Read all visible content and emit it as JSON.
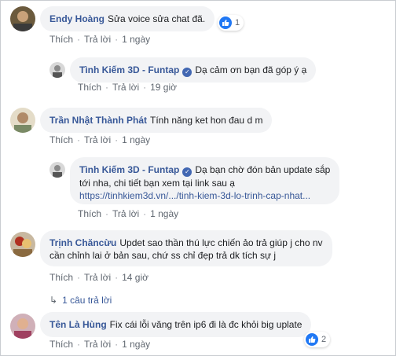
{
  "comments": [
    {
      "author": "Endy Hoàng",
      "text": "Sửa voice sửa chat đã.",
      "reaction_count": "1",
      "actions": {
        "like": "Thích",
        "reply": "Trả lời",
        "time": "1 ngày"
      },
      "reply": {
        "author": "Tình Kiếm 3D - Funtap",
        "text": "Dạ cảm ơn bạn đã góp ý ạ",
        "actions": {
          "like": "Thích",
          "reply": "Trả lời",
          "time": "19 giờ"
        }
      }
    },
    {
      "author": "Trần Nhật Thành Phát",
      "text": "Tính năng ket hon đau d m",
      "actions": {
        "like": "Thích",
        "reply": "Trả lời",
        "time": "1 ngày"
      },
      "reply": {
        "author": "Tình Kiếm 3D - Funtap",
        "text_line1": "Dạ bạn chờ đón bản update sắp",
        "text_line2": "tới nha, chi tiết bạn xem tại link sau ạ",
        "link": "https://tinhkiem3d.vn/.../tinh-kiem-3d-lo-trinh-cap-nhat...",
        "actions": {
          "like": "Thích",
          "reply": "Trả lời",
          "time": "1 ngày"
        }
      }
    },
    {
      "author": "Trịnh Chăncừu",
      "text_line1": "Updet sao thần thú lực chiến ảo trả giúp j cho nv",
      "text_line2": "cần chỉnh lai ở bản sau, chứ ss chỉ đẹp trả dk tích sự j",
      "actions": {
        "like": "Thích",
        "reply": "Trả lời",
        "time": "14 giờ"
      },
      "replies_link": "1 câu trả lời"
    },
    {
      "author": "Tên Là Hùng",
      "text": "Fix cái lỗi văng trên ip6 đi là đc khỏi big uplate",
      "reaction_count": "2",
      "actions": {
        "like": "Thích",
        "reply": "Trả lời",
        "time": "1 ngày"
      }
    }
  ],
  "colors": {
    "author_link": "#385898",
    "bubble_bg": "#f2f3f5",
    "meta_gray": "#606770",
    "like_blue": "#2078f4",
    "verified_blue": "#4267b2"
  },
  "icons": [
    "avatar",
    "verified-badge-icon",
    "like-reaction-icon",
    "reply-arrow-icon"
  ]
}
